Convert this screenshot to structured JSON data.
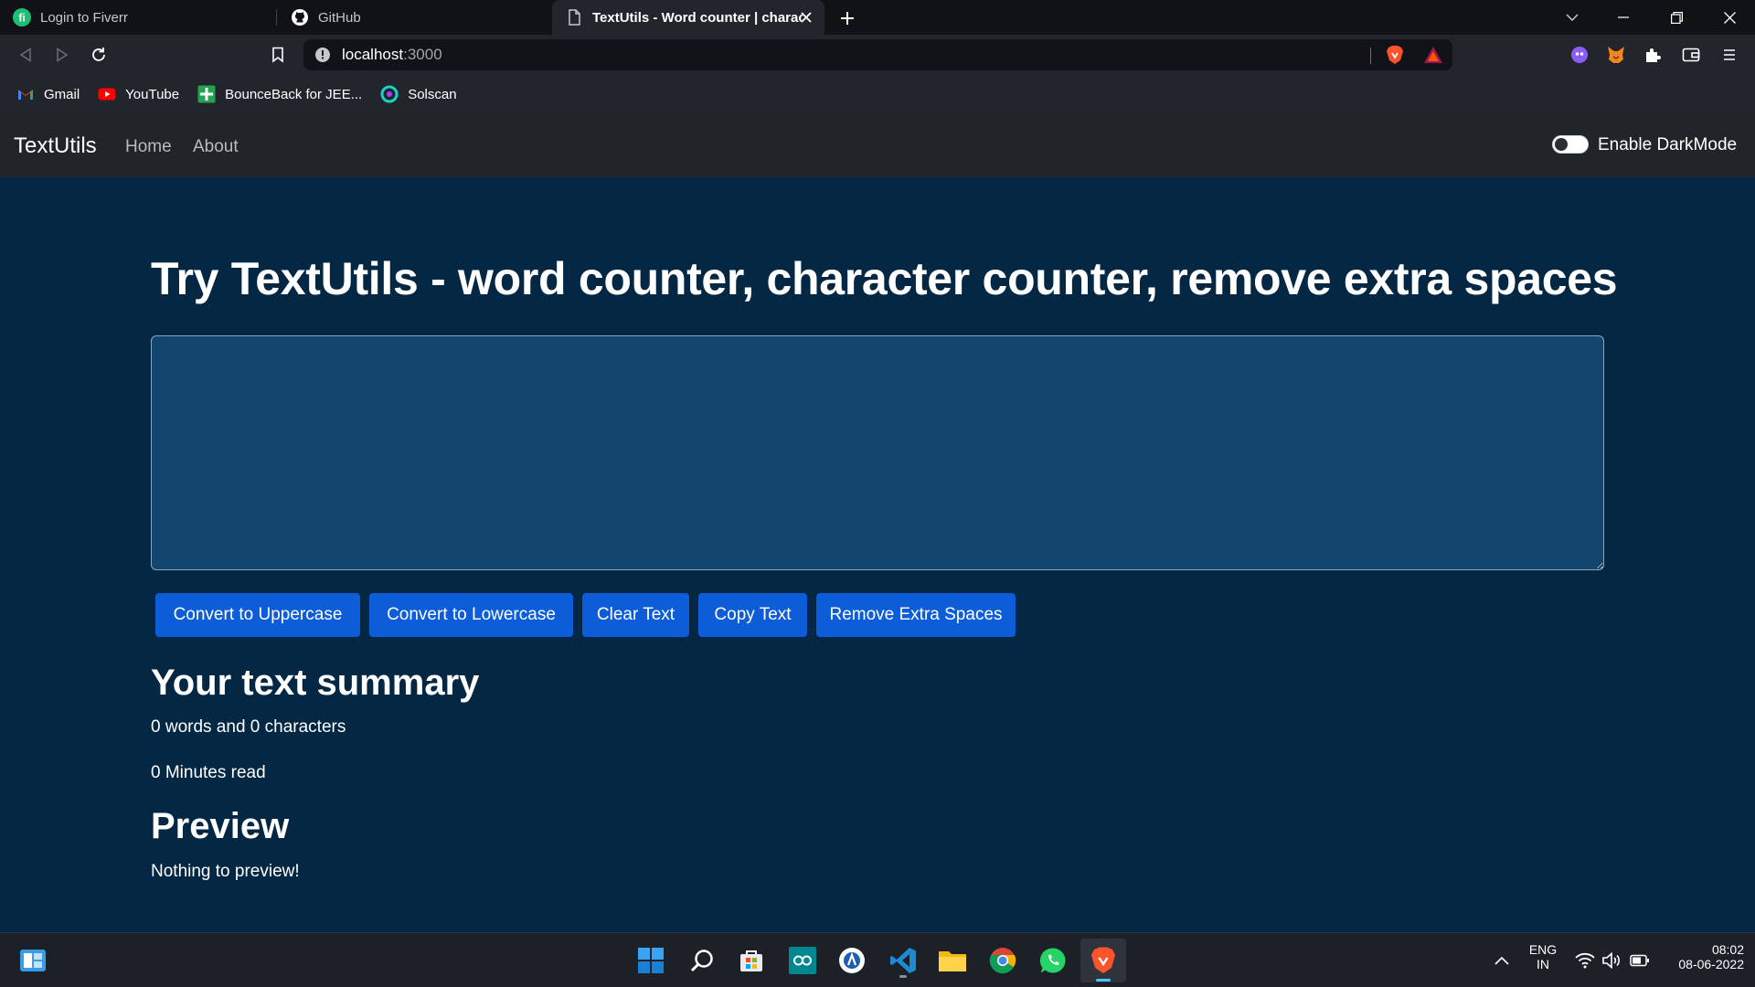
{
  "browser": {
    "tabs": [
      {
        "title": "Login to Fiverr",
        "icon": "fiverr-icon"
      },
      {
        "title": "GitHub",
        "icon": "github-icon"
      },
      {
        "title": "TextUtils - Word counter | charact",
        "icon": "page-icon",
        "active": true
      }
    ],
    "url_host": "localhost",
    "url_port": ":3000",
    "bookmarks": [
      {
        "label": "Gmail",
        "icon": "gmail-icon"
      },
      {
        "label": "YouTube",
        "icon": "youtube-icon"
      },
      {
        "label": "BounceBack for JEE...",
        "icon": "bounceback-icon"
      },
      {
        "label": "Solscan",
        "icon": "solscan-icon"
      }
    ]
  },
  "navbar": {
    "brand": "TextUtils",
    "links": [
      "Home",
      "About"
    ],
    "darkmode_label": "Enable DarkMode",
    "darkmode_on": false
  },
  "main": {
    "heading": "Try TextUtils - word counter, character counter, remove extra spaces",
    "textarea_value": "",
    "buttons": [
      "Convert to Uppercase",
      "Convert to Lowercase",
      "Clear Text",
      "Copy Text",
      "Remove Extra Spaces"
    ],
    "summary_title": "Your text summary",
    "word_char_count": "0 words and 0 characters",
    "minutes_read": "0 Minutes read",
    "preview_title": "Preview",
    "preview_text": "Nothing to preview!"
  },
  "taskbar": {
    "language": "ENG",
    "region": "IN",
    "time": "08:02",
    "date": "08-06-2022"
  },
  "colors": {
    "page_bg": "#042743",
    "navbar_bg": "#212529",
    "button_bg": "#0d5dd8",
    "textarea_bg": "#13466e"
  }
}
